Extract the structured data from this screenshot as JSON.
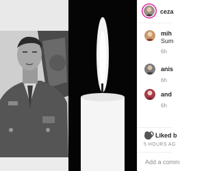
{
  "post": {
    "owner_handle": "ceza",
    "liked_by_label": "Liked b",
    "time_label": "5 HOURS AG",
    "add_comment_placeholder": "Add a comm"
  },
  "comments": [
    {
      "username": "mih",
      "text": "Sum",
      "time": "6h"
    },
    {
      "username": "anis",
      "text": "",
      "time": "6h"
    },
    {
      "username": "and",
      "text": "",
      "time": "6h"
    }
  ],
  "colors": {
    "story_ring": "#d6249f",
    "muted_text": "#8e8e8e",
    "border": "#efefef"
  }
}
